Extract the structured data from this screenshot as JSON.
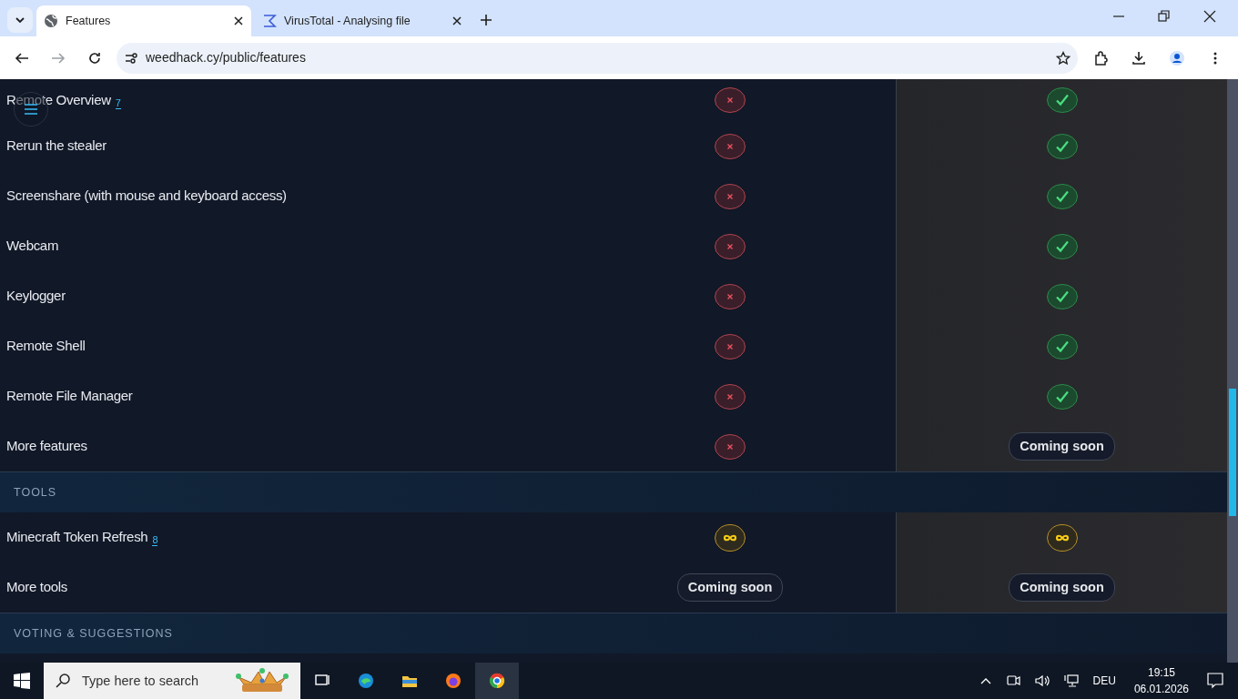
{
  "browser": {
    "tabs": [
      {
        "title": "Features",
        "selected": true
      },
      {
        "title": "VirusTotal - Analysing file",
        "selected": false
      }
    ],
    "url": "weedhack.cy/public/features"
  },
  "sections": [
    {
      "rows": [
        {
          "label": "Remote Overview",
          "note": "7",
          "cells": [
            {
              "kind": "cross"
            },
            {
              "kind": "check"
            }
          ]
        },
        {
          "label": "Rerun the stealer",
          "cells": [
            {
              "kind": "cross"
            },
            {
              "kind": "check"
            }
          ]
        },
        {
          "label": "Screenshare (with mouse and keyboard access)",
          "cells": [
            {
              "kind": "cross"
            },
            {
              "kind": "check"
            }
          ]
        },
        {
          "label": "Webcam",
          "cells": [
            {
              "kind": "cross"
            },
            {
              "kind": "check"
            }
          ]
        },
        {
          "label": "Keylogger",
          "cells": [
            {
              "kind": "cross"
            },
            {
              "kind": "check"
            }
          ]
        },
        {
          "label": "Remote Shell",
          "cells": [
            {
              "kind": "cross"
            },
            {
              "kind": "check"
            }
          ]
        },
        {
          "label": "Remote File Manager",
          "cells": [
            {
              "kind": "cross"
            },
            {
              "kind": "check"
            }
          ]
        },
        {
          "label": "More features",
          "cells": [
            {
              "kind": "cross"
            },
            {
              "kind": "text",
              "text": "Coming soon"
            }
          ]
        }
      ]
    },
    {
      "title": "TOOLS",
      "rows": [
        {
          "label": "Minecraft Token Refresh",
          "note": "8",
          "cells": [
            {
              "kind": "infinity"
            },
            {
              "kind": "infinity"
            }
          ]
        },
        {
          "label": "More tools",
          "cells": [
            {
              "kind": "text",
              "text": "Coming soon"
            },
            {
              "kind": "text",
              "text": "Coming soon"
            }
          ]
        }
      ]
    },
    {
      "title": "VOTING & SUGGESTIONS"
    }
  ],
  "taskbar": {
    "search_placeholder": "Type here to search",
    "language": "DEU",
    "time": "19:15",
    "date": "06.01.2026"
  }
}
